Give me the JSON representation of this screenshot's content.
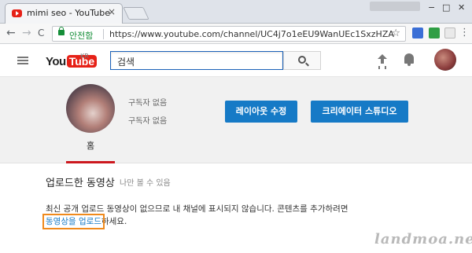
{
  "browser": {
    "tab_title": "mimi seo - YouTube",
    "tab_close": "×",
    "win_min": "−",
    "win_max": "□",
    "win_close": "✕",
    "back": "←",
    "forward": "→",
    "reload": "C",
    "secure_label": "안전함",
    "url": "https://www.youtube.com/channel/UC4j7o1eEU9WanUEc1SxzHZA",
    "star": "☆",
    "menu": "⋮",
    "extension_colors": [
      "#3b6fd6",
      "#2f9e44"
    ]
  },
  "youtube": {
    "logo_you": "You",
    "logo_tube": "Tube",
    "logo_region": "KR",
    "search_placeholder": "검색",
    "accent": "#e62117",
    "button_color": "#167ac6"
  },
  "channel": {
    "subscriber_line1": "구독자 없음",
    "subscriber_line2": "구독자 없음",
    "edit_layout_button": "레이아웃 수정",
    "creator_studio_button": "크리에이터 스튜디오",
    "home_tab": "홈"
  },
  "content": {
    "section_title": "업로드한 동영상",
    "section_note": "나만 볼 수 있음",
    "empty_message": "최신 공개 업로드 동영상이 없으므로 내 채널에 표시되지 않습니다. 콘텐츠를 추가하려면",
    "upload_link": "동영상을 업로드",
    "upload_suffix": "하세요."
  },
  "watermark": "landmoa.net"
}
